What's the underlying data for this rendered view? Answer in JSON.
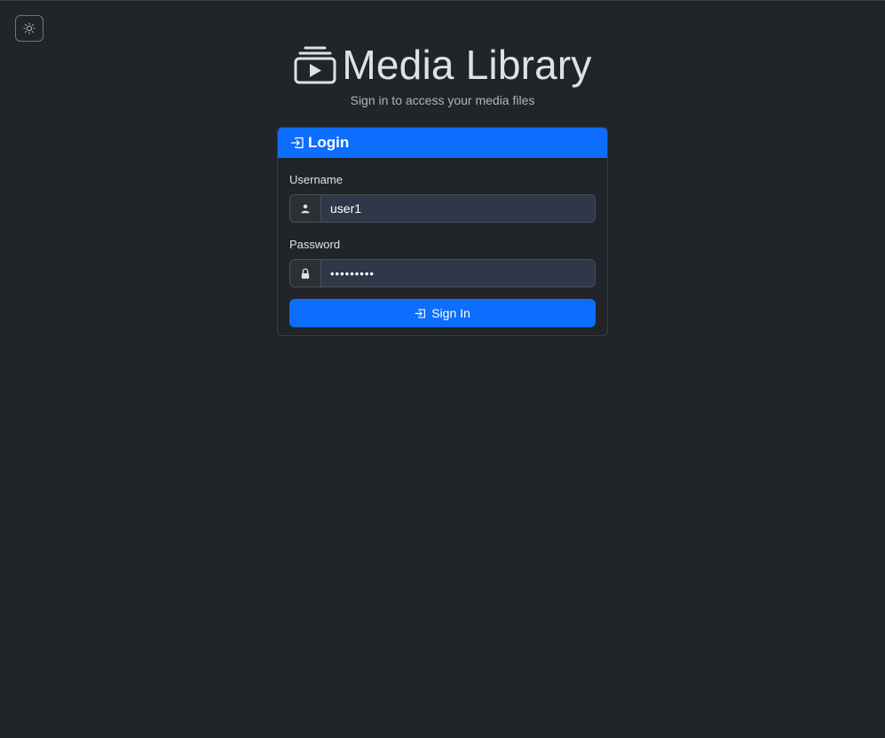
{
  "theme_toggle": {
    "icon": "sun-icon"
  },
  "header": {
    "logo_icon": "collection-play-icon",
    "title": "Media Library",
    "subtitle": "Sign in to access your media files"
  },
  "login_card": {
    "header_icon": "box-arrow-in-right-icon",
    "title": "Login",
    "username": {
      "label": "Username",
      "icon": "person-icon",
      "value": "user1"
    },
    "password": {
      "label": "Password",
      "icon": "lock-icon",
      "value": "•••••••••"
    },
    "submit": {
      "icon": "box-arrow-in-right-icon",
      "label": "Sign In"
    }
  },
  "colors": {
    "background": "#212529",
    "primary": "#0d6efd",
    "input_bg": "#2f3749",
    "text": "#dee2e6",
    "muted": "#adb5bd"
  }
}
